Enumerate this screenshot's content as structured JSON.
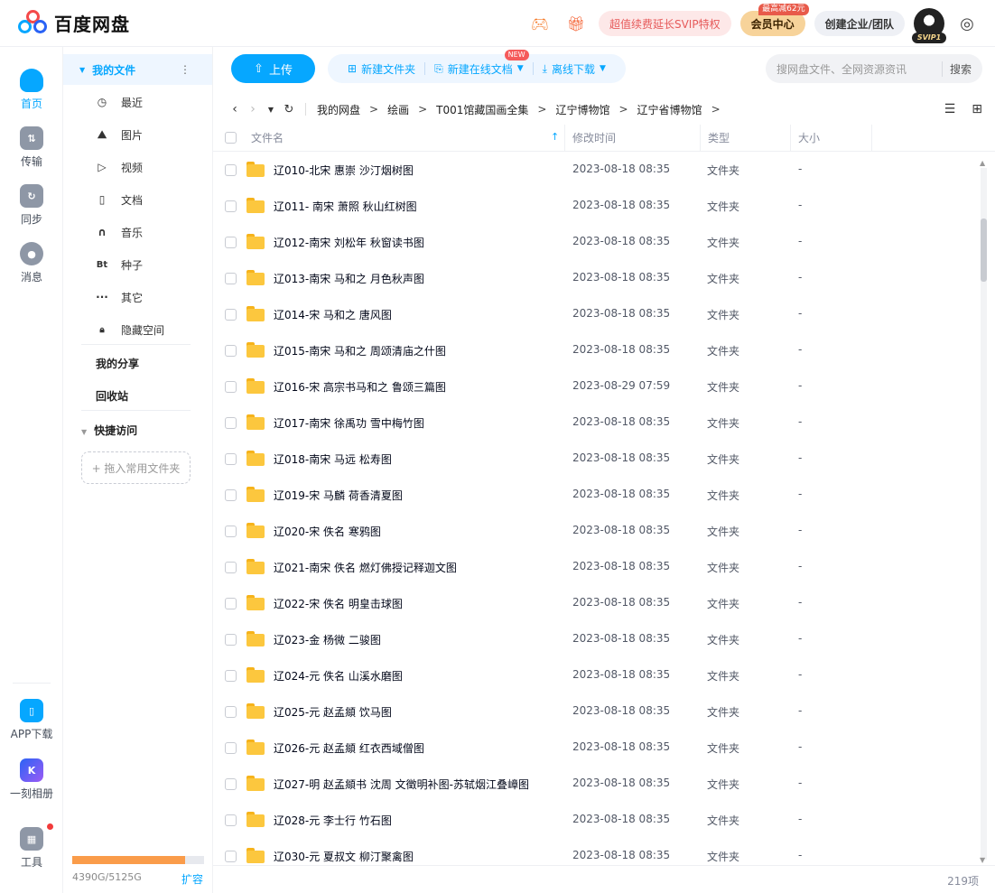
{
  "app": {
    "name": "百度网盘"
  },
  "header": {
    "svip_promo": "超值续费延长SVIP特权",
    "vip_center": "会员中心",
    "vip_tag": "最高减62元",
    "team": "创建企业/团队",
    "avatar_badge": "SVIP1"
  },
  "rail": {
    "items": [
      {
        "label": "首页",
        "icon": "cloud-home-icon"
      },
      {
        "label": "传输",
        "icon": "transfer-icon"
      },
      {
        "label": "同步",
        "icon": "sync-icon"
      },
      {
        "label": "消息",
        "icon": "message-icon"
      }
    ],
    "bottom": [
      {
        "label": "APP下载",
        "icon": "phone-app-icon"
      },
      {
        "label": "一刻相册",
        "icon": "album-icon"
      },
      {
        "label": "工具",
        "icon": "tools-icon"
      }
    ]
  },
  "sidebar": {
    "my_files": "我的文件",
    "more": "⋮",
    "items": [
      {
        "label": "最近",
        "icon": "clock-icon",
        "glyph": "◷"
      },
      {
        "label": "图片",
        "icon": "image-icon",
        "glyph": "⛰"
      },
      {
        "label": "视频",
        "icon": "video-icon",
        "glyph": "▷"
      },
      {
        "label": "文档",
        "icon": "document-icon",
        "glyph": "▯"
      },
      {
        "label": "音乐",
        "icon": "headphones-icon",
        "glyph": "∩"
      },
      {
        "label": "种子",
        "icon": "bt-icon",
        "glyph": "Bt"
      },
      {
        "label": "其它",
        "icon": "more-icon",
        "glyph": "···"
      },
      {
        "label": "隐藏空间",
        "icon": "lock-icon",
        "glyph": "🔒︎"
      }
    ],
    "my_share": "我的分享",
    "recycle": "回收站",
    "quick_access": "快捷访问",
    "drop_hint": "+ 拖入常用文件夹",
    "quota_text": "4390G/5125G",
    "quota_used_fraction": 0.857,
    "expand": "扩容"
  },
  "toolbar": {
    "upload": "上传",
    "new_folder": "新建文件夹",
    "new_online_doc": "新建在线文档",
    "new_tag": "NEW",
    "offline_download": "离线下载",
    "search_placeholder": "搜网盘文件、全网资源资讯",
    "search_button": "搜索"
  },
  "breadcrumb": [
    "我的网盘",
    "绘画",
    "T001馆藏国画全集",
    "辽宁博物馆",
    "辽宁省博物馆"
  ],
  "table": {
    "headers": {
      "name": "文件名",
      "time": "修改时间",
      "type": "类型",
      "size": "大小"
    },
    "rows": [
      {
        "name": "辽010-北宋 惠崇 沙汀烟树图",
        "time": "2023-08-18 08:35",
        "type": "文件夹",
        "size": "-"
      },
      {
        "name": "辽011- 南宋 萧照  秋山红树图",
        "time": "2023-08-18 08:35",
        "type": "文件夹",
        "size": "-"
      },
      {
        "name": "辽012-南宋 刘松年 秋窗读书图",
        "time": "2023-08-18 08:35",
        "type": "文件夹",
        "size": "-"
      },
      {
        "name": "辽013-南宋 马和之 月色秋声图",
        "time": "2023-08-18 08:35",
        "type": "文件夹",
        "size": "-"
      },
      {
        "name": "辽014-宋 马和之 唐风图",
        "time": "2023-08-18 08:35",
        "type": "文件夹",
        "size": "-"
      },
      {
        "name": "辽015-南宋 马和之 周颂清庙之什图",
        "time": "2023-08-18 08:35",
        "type": "文件夹",
        "size": "-"
      },
      {
        "name": "辽016-宋 高宗书马和之 鲁颂三篇图",
        "time": "2023-08-29 07:59",
        "type": "文件夹",
        "size": "-"
      },
      {
        "name": "辽017-南宋 徐禹功 雪中梅竹图",
        "time": "2023-08-18 08:35",
        "type": "文件夹",
        "size": "-"
      },
      {
        "name": "辽018-南宋 马远 松寿图",
        "time": "2023-08-18 08:35",
        "type": "文件夹",
        "size": "-"
      },
      {
        "name": "辽019-宋 马麟 荷香清夏图",
        "time": "2023-08-18 08:35",
        "type": "文件夹",
        "size": "-"
      },
      {
        "name": "辽020-宋 佚名 寒鸦图",
        "time": "2023-08-18 08:35",
        "type": "文件夹",
        "size": "-"
      },
      {
        "name": "辽021-南宋 佚名 燃灯佛授记释迦文图",
        "time": "2023-08-18 08:35",
        "type": "文件夹",
        "size": "-"
      },
      {
        "name": "辽022-宋 佚名 明皇击球图",
        "time": "2023-08-18 08:35",
        "type": "文件夹",
        "size": "-"
      },
      {
        "name": "辽023-金 杨微 二骏图",
        "time": "2023-08-18 08:35",
        "type": "文件夹",
        "size": "-"
      },
      {
        "name": "辽024-元 佚名 山溪水磨图",
        "time": "2023-08-18 08:35",
        "type": "文件夹",
        "size": "-"
      },
      {
        "name": "辽025-元 赵孟頫 饮马图",
        "time": "2023-08-18 08:35",
        "type": "文件夹",
        "size": "-"
      },
      {
        "name": "辽026-元  赵孟頫 红衣西域僧图",
        "time": "2023-08-18 08:35",
        "type": "文件夹",
        "size": "-"
      },
      {
        "name": "辽027-明 赵孟頫书 沈周 文徵明补图-苏轼烟江叠嶂图",
        "time": "2023-08-18 08:35",
        "type": "文件夹",
        "size": "-"
      },
      {
        "name": "辽028-元 李士行 竹石图",
        "time": "2023-08-18 08:35",
        "type": "文件夹",
        "size": "-"
      },
      {
        "name": "辽030-元 夏叔文 柳汀聚禽图",
        "time": "2023-08-18 08:35",
        "type": "文件夹",
        "size": "-"
      }
    ],
    "count": "219项"
  },
  "colors": {
    "accent": "#06a7ff",
    "folder": "#fcc73e",
    "quota": "#fa9c4a"
  }
}
